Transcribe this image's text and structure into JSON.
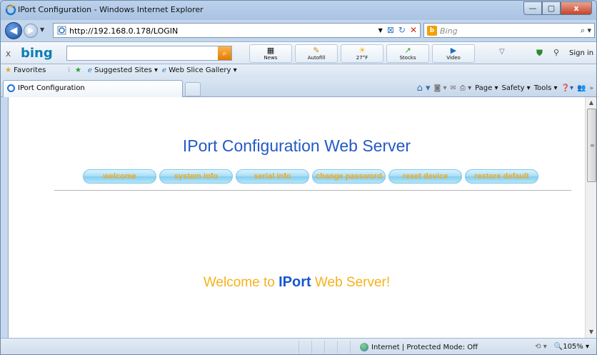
{
  "window": {
    "title": "IPort Configuration - Windows Internet Explorer",
    "min_icon": "—",
    "max_icon": "▢",
    "close_icon": "x"
  },
  "address": {
    "url": "http://192.168.0.178/LOGIN",
    "search_placeholder": "Bing"
  },
  "bing_toolbar": {
    "logo": "bing",
    "search_value": "",
    "buttons": [
      {
        "label": "News",
        "icon": "news-icon",
        "glyph": "▦"
      },
      {
        "label": "Autofill",
        "icon": "pencil-icon",
        "glyph": "✎"
      },
      {
        "label": "27°F",
        "icon": "sun-icon",
        "glyph": "☀"
      },
      {
        "label": "Stocks",
        "icon": "stocks-icon",
        "glyph": "↗"
      },
      {
        "label": "Video",
        "icon": "play-icon",
        "glyph": "▶"
      }
    ],
    "signin": "Sign in"
  },
  "favorites": {
    "favorites_label": "Favorites",
    "suggested_label": "Suggested Sites ▾",
    "webslice_label": "Web Slice Gallery ▾"
  },
  "tabs": {
    "active_label": "IPort Configuration"
  },
  "command_bar": {
    "page": "Page ▾",
    "safety": "Safety ▾",
    "tools": "Tools ▾"
  },
  "page": {
    "title": "IPort Configuration Web Server",
    "menu": [
      "welcome",
      "system info",
      "serial info",
      "change password",
      "reset device",
      "restore default"
    ],
    "welcome_prefix": "Welcome to ",
    "welcome_brand": "IPort",
    "welcome_suffix": " Web Server!"
  },
  "status": {
    "zone": "Internet | Protected Mode: Off",
    "zoom": "105%"
  },
  "colors": {
    "title": "#2359c5",
    "menu_text": "#f2a71c",
    "welcome": "#f6b21b",
    "brand": "#1657d0"
  }
}
